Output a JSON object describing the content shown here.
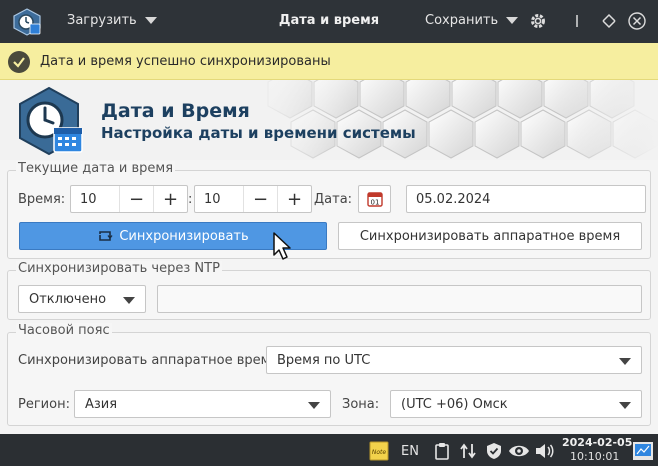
{
  "window": {
    "title": "Дата и время",
    "menu_load": "Загрузить",
    "menu_save": "Сохранить"
  },
  "notification": {
    "text": "Дата и время успешно синхронизированы"
  },
  "header": {
    "title": "Дата и Время",
    "subtitle": "Настройка даты и времени системы"
  },
  "current": {
    "group_title": "Текущие дата и время",
    "time_label": "Время:",
    "hours": "10",
    "minutes": "10",
    "separator": ":",
    "date_label": "Дата:",
    "calendar_day": "01",
    "date_value": "05.02.2024",
    "sync_button": "Синхронизировать",
    "sync_hw_button": "Синхронизировать аппаратное время",
    "minus": "−",
    "plus": "+"
  },
  "ntp": {
    "group_title": "Синхронизировать через NTP",
    "mode": "Отключено",
    "server": ""
  },
  "timezone": {
    "group_title": "Часовой пояс",
    "hw_label": "Синхронизировать аппаратное время:",
    "hw_value": "Время по UTC",
    "region_label": "Регион:",
    "region_value": "Азия",
    "zone_label": "Зона:",
    "zone_value": "(UTC +06) Омск"
  },
  "taskbar": {
    "notes_label": "Note",
    "lang": "EN",
    "date": "2024-02-05",
    "time": "10:10:01"
  },
  "colors": {
    "titlebar": "#2e3338",
    "notification_bg": "#f6ee9f",
    "accent": "#4f97e3",
    "header_text": "#1d4060",
    "taskbar": "#2b2f33"
  }
}
